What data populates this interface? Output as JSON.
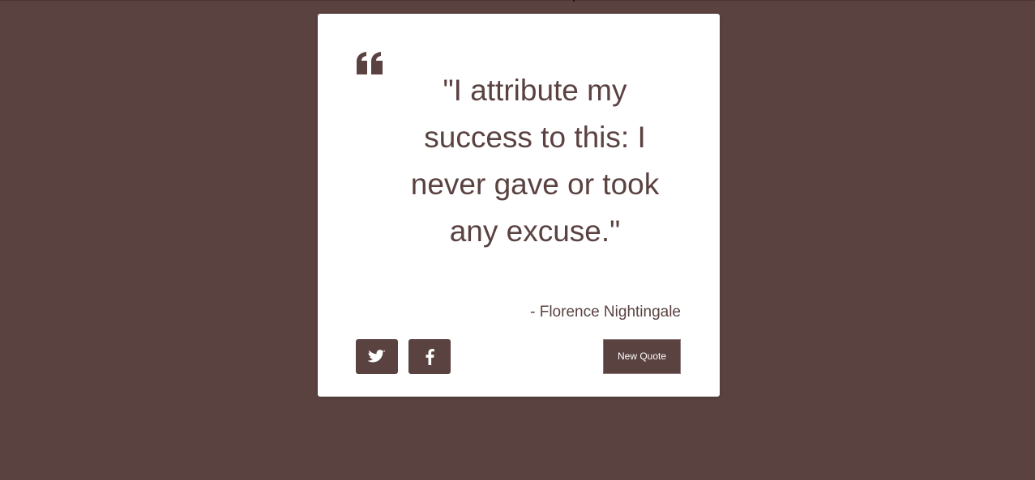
{
  "quote": {
    "text": "\"I attribute my success to this: I never gave or took any excuse.\"",
    "author": "- Florence Nightingale"
  },
  "buttons": {
    "new_quote_label": "New Quote",
    "twitter_icon": "twitter-icon",
    "facebook_icon": "facebook-icon"
  },
  "colors": {
    "background": "#5a4241",
    "card": "#ffffff",
    "accent": "#5a4241"
  }
}
